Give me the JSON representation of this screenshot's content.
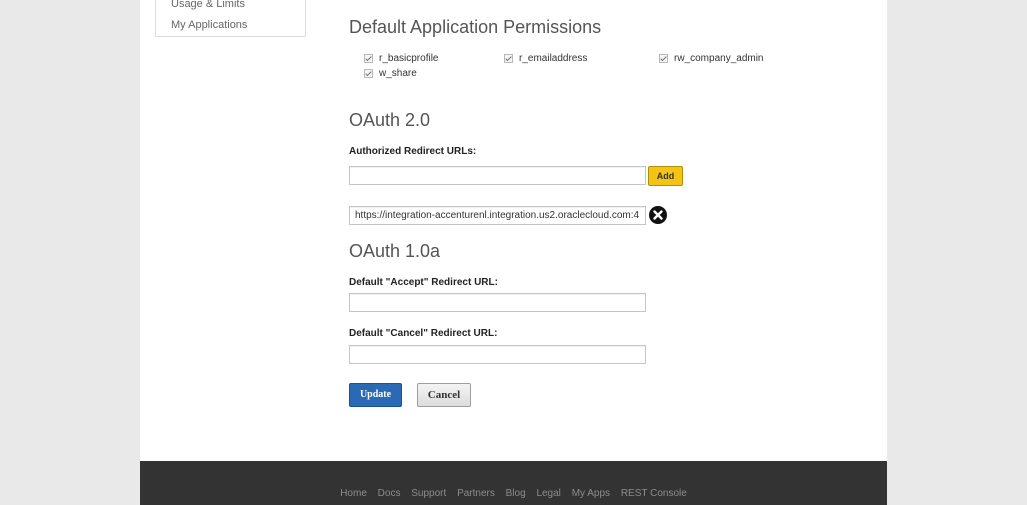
{
  "sidebar": {
    "items": [
      {
        "label": "Usage & Limits"
      },
      {
        "label": "My Applications"
      }
    ]
  },
  "permissions": {
    "title": "Default Application Permissions",
    "items": [
      {
        "label": "r_basicprofile",
        "checked": true
      },
      {
        "label": "r_emailaddress",
        "checked": true
      },
      {
        "label": "rw_company_admin",
        "checked": true
      },
      {
        "label": "w_share",
        "checked": true
      }
    ]
  },
  "oauth2": {
    "title": "OAuth 2.0",
    "redirect_label": "Authorized Redirect URLs:",
    "redirect_input_value": "",
    "add_label": "Add",
    "existing_url": "https://integration-accenturenl.integration.us2.oraclecloud.com:4"
  },
  "oauth1": {
    "title": "OAuth 1.0a",
    "accept_label": "Default \"Accept\" Redirect URL:",
    "accept_value": "",
    "cancel_label": "Default \"Cancel\" Redirect URL:",
    "cancel_value": ""
  },
  "actions": {
    "update_label": "Update",
    "cancel_label": "Cancel"
  },
  "footer": {
    "links": [
      "Home",
      "Docs",
      "Support",
      "Partners",
      "Blog",
      "Legal",
      "My Apps",
      "REST Console"
    ]
  },
  "colors": {
    "add_button": "#f3c316",
    "update_button": "#2a6ab4",
    "footer_bg": "#333333"
  }
}
